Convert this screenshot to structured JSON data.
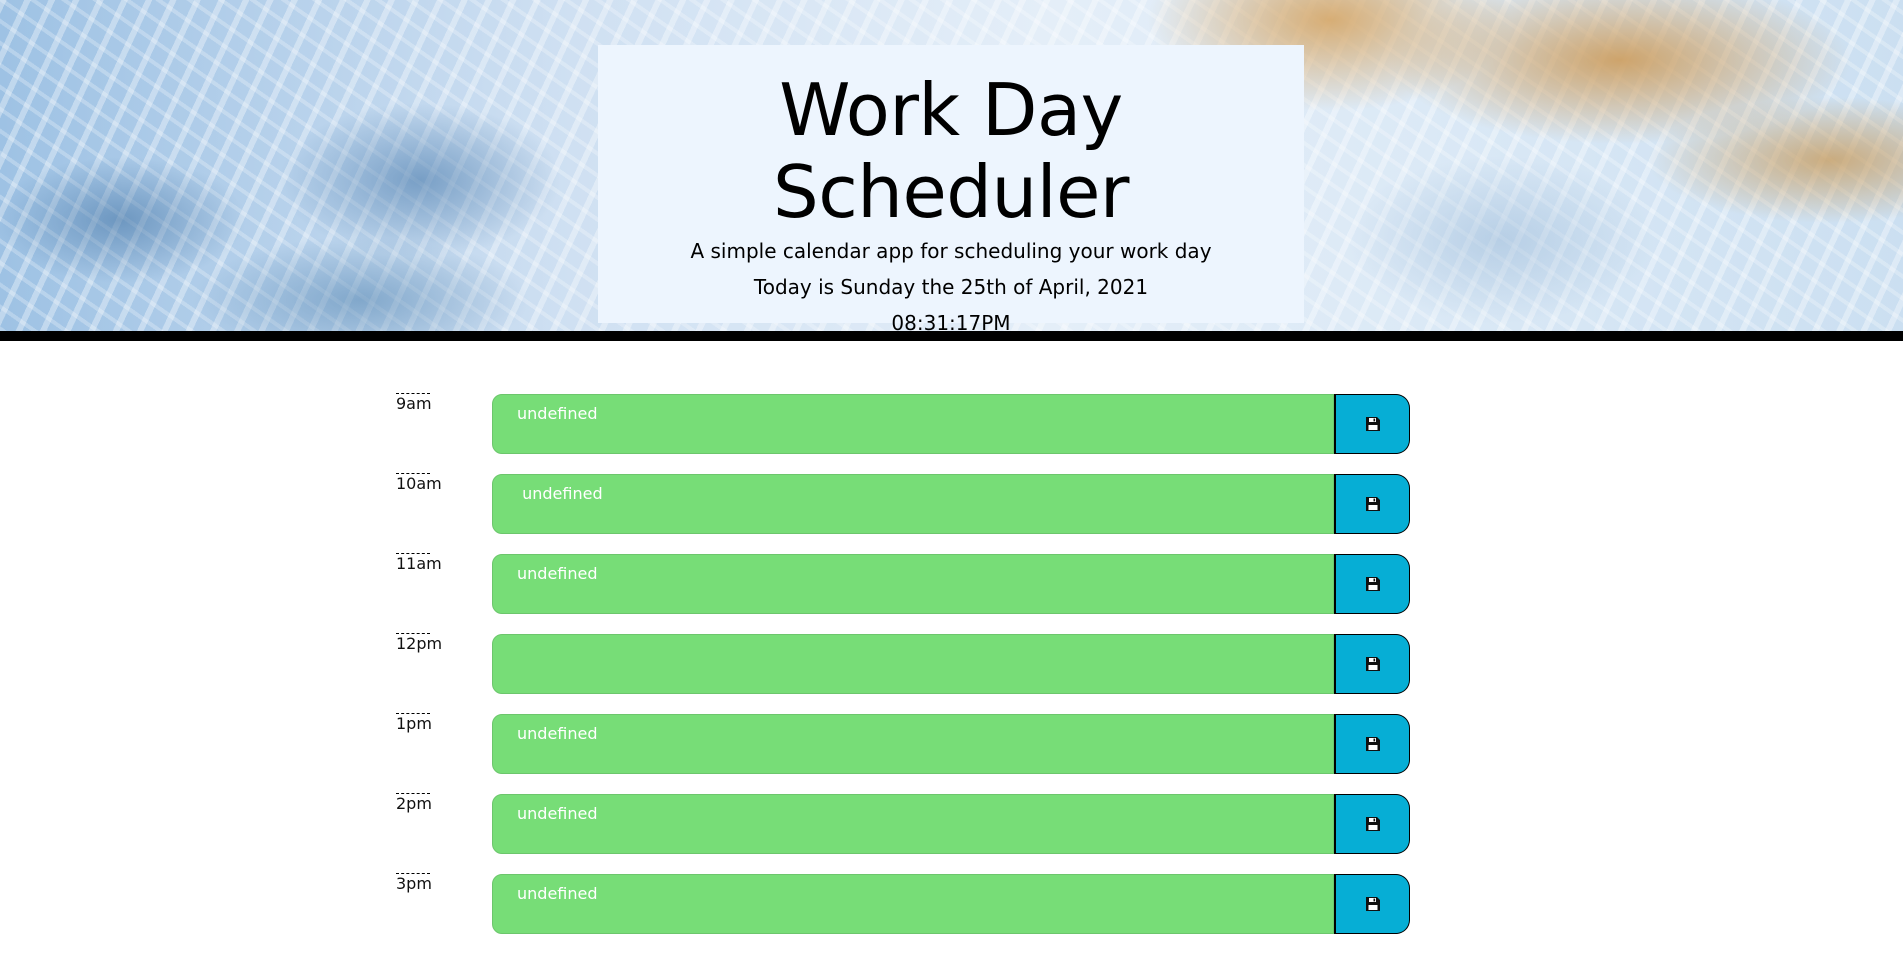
{
  "header": {
    "title": "Work Day Scheduler",
    "subtitle": "A simple calendar app for scheduling your work day",
    "date_line": "Today is Sunday the 25th of April, 2021",
    "clock": "08:31:17PM"
  },
  "colors": {
    "task_bg": "#77dd77",
    "save_bg": "#06aed5",
    "jumbotron_bg": "#edf5fe"
  },
  "icons": {
    "save": "floppy-disk-icon"
  },
  "rows": [
    {
      "hour": "9am",
      "text": "undefined"
    },
    {
      "hour": "10am",
      "text": " undefined"
    },
    {
      "hour": "11am",
      "text": "undefined"
    },
    {
      "hour": "12pm",
      "text": ""
    },
    {
      "hour": "1pm",
      "text": "undefined"
    },
    {
      "hour": "2pm",
      "text": "undefined"
    },
    {
      "hour": "3pm",
      "text": "undefined"
    }
  ]
}
